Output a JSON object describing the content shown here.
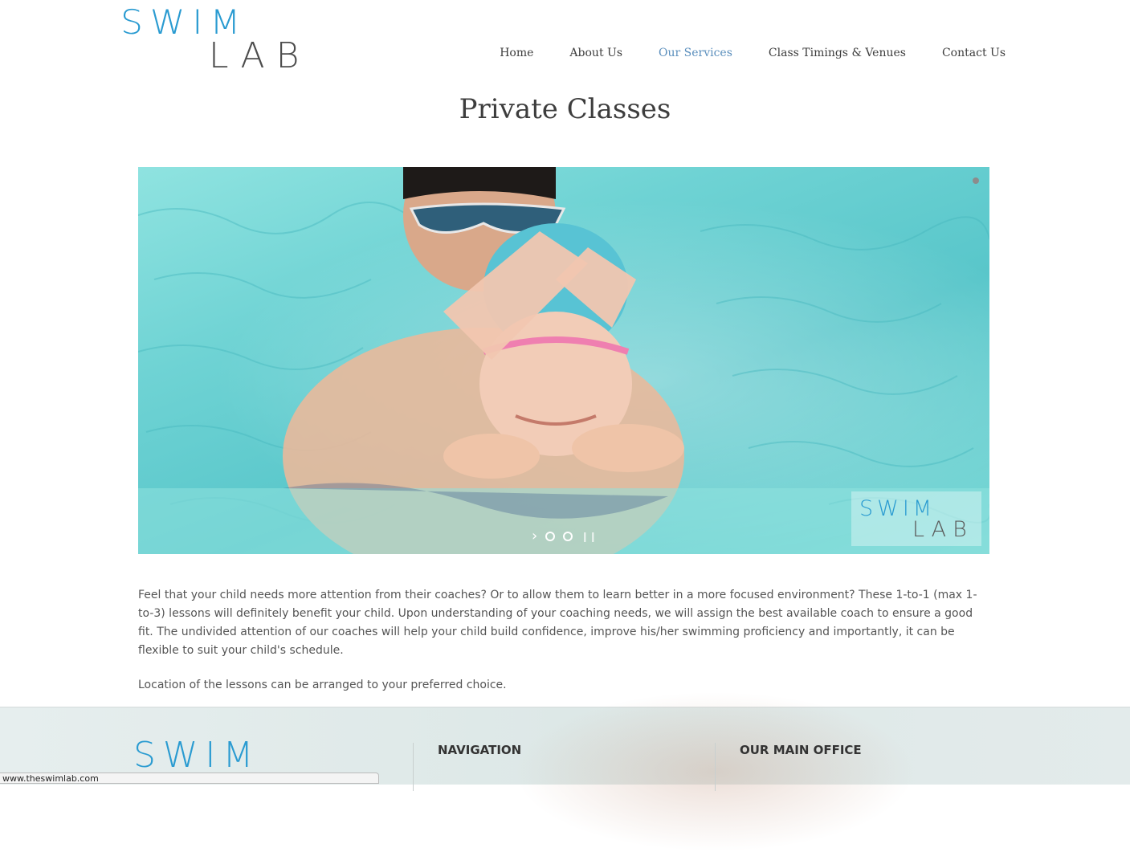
{
  "header": {
    "logo_top": "SWIM",
    "logo_bottom": "LAB",
    "nav": [
      {
        "label": "Home",
        "active": false
      },
      {
        "label": "About Us",
        "active": false
      },
      {
        "label": "Our Services",
        "active": true
      },
      {
        "label": "Class Timings & Venues",
        "active": false
      },
      {
        "label": "Contact Us",
        "active": false
      }
    ]
  },
  "page": {
    "title": "Private Classes"
  },
  "slider": {
    "watermark_top": "SWIM",
    "watermark_bottom": "LAB",
    "next_icon": "chevron-right-icon",
    "slide_count": 2,
    "active_slide": 1
  },
  "content": {
    "paragraph_1": "Feel that your child needs more attention from their coaches?  Or to allow them to learn better in a more focused environment? These 1-to-1 (max 1-to-3) lessons will definitely benefit your child. Upon understanding of your coaching needs, we will assign the best available coach to ensure a good fit. The undivided attention of our coaches will help your child build confidence, improve his/her swimming proficiency and importantly, it can be flexible to suit your child's schedule.",
    "paragraph_2": "Location of the lessons can be arranged to your preferred choice."
  },
  "footer": {
    "logo": "SWIM",
    "nav_heading": "NAVIGATION",
    "office_heading": "OUR MAIN OFFICE"
  },
  "status_bar": {
    "url": "www.theswimlab.com"
  },
  "colors": {
    "brand_blue": "#2a9bd1",
    "nav_active": "#5b8fbd",
    "text": "#3d3d3d"
  }
}
